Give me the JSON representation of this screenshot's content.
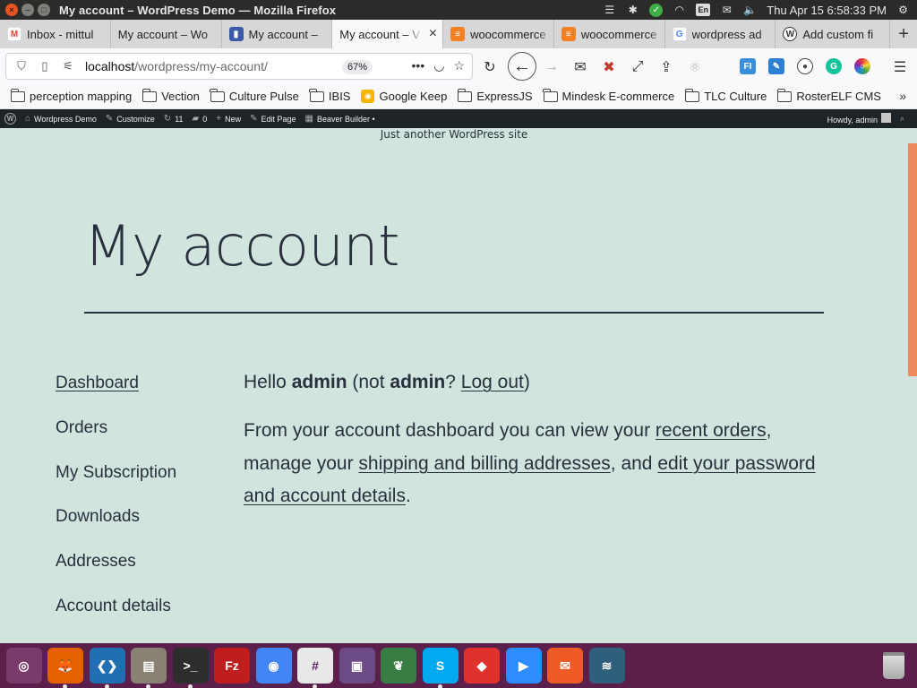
{
  "system": {
    "window_title": "My account – WordPress Demo — Mozilla Firefox",
    "clock": "Thu Apr 15  6:58:33 PM",
    "keyboard": "En"
  },
  "tabs": [
    {
      "label": "Inbox - mittul",
      "icon": "gmail-icon",
      "color": "#ea4335"
    },
    {
      "label": "My account – Wo",
      "icon": "page-icon",
      "color": "#888888"
    },
    {
      "label": "My account –",
      "icon": "chart-icon",
      "color": "#3b5ba9"
    },
    {
      "label": "My account – V",
      "icon": "page-icon",
      "color": "#888888",
      "active": true
    },
    {
      "label": "woocommerce",
      "icon": "stackoverflow-icon",
      "color": "#f48024"
    },
    {
      "label": "woocommerce",
      "icon": "stackoverflow-icon",
      "color": "#f48024"
    },
    {
      "label": "wordpress ad",
      "icon": "google-icon",
      "color": "#4285f4"
    },
    {
      "label": "Add custom fi",
      "icon": "wordpress-icon",
      "color": "#333333"
    }
  ],
  "url": {
    "host": "localhost",
    "path": "/wordpress/my-account/",
    "zoom": "67%"
  },
  "bookmarks": [
    {
      "label": "perception mapping",
      "type": "folder"
    },
    {
      "label": "Vection",
      "type": "folder"
    },
    {
      "label": "Culture Pulse",
      "type": "folder"
    },
    {
      "label": "IBIS",
      "type": "folder"
    },
    {
      "label": "Google Keep",
      "type": "keep"
    },
    {
      "label": "ExpressJS",
      "type": "folder"
    },
    {
      "label": "Mindesk E-commerce",
      "type": "folder"
    },
    {
      "label": "TLC Culture",
      "type": "folder"
    },
    {
      "label": "RosterELF CMS",
      "type": "folder"
    }
  ],
  "wpbar": {
    "site": "Wordpress Demo",
    "customize": "Customize",
    "updates": "11",
    "comments": "0",
    "new": "New",
    "edit": "Edit Page",
    "builder": "Beaver Builder •",
    "howdy": "Howdy, admin"
  },
  "site": {
    "tagline": "Just another WordPress site"
  },
  "page": {
    "title": "My account"
  },
  "account_nav": [
    {
      "label": "Dashboard",
      "current": true
    },
    {
      "label": "Orders"
    },
    {
      "label": "My Subscription"
    },
    {
      "label": "Downloads"
    },
    {
      "label": "Addresses"
    },
    {
      "label": "Account details"
    }
  ],
  "dashboard": {
    "hello": "Hello",
    "user": "admin",
    "not_prefix": " (not ",
    "not_user": "admin",
    "q": "? ",
    "logout": "Log out",
    "close": ")",
    "intro_1": "From your account dashboard you can view your ",
    "link_orders": "recent orders",
    "intro_2": ", manage your ",
    "link_addresses": "shipping and billing addresses",
    "intro_3": ", and ",
    "link_account": "edit your password and account details",
    "intro_4": "."
  },
  "colors": {
    "page_bg": "#d1e4dd",
    "text": "#28303d",
    "dock": "#5a1f4b",
    "scroll_accent": "#f08a5d"
  },
  "dock": [
    {
      "name": "ubuntu-icon",
      "color": "#7a3a6a",
      "glyph": "◎"
    },
    {
      "name": "firefox-icon",
      "color": "#e66000",
      "glyph": "🦊",
      "running": true
    },
    {
      "name": "vscode-icon",
      "color": "#1f6fb2",
      "glyph": "❮❯",
      "running": true
    },
    {
      "name": "files-icon",
      "color": "#8a8175",
      "glyph": "▤",
      "running": true
    },
    {
      "name": "terminal-icon",
      "color": "#2d2d2d",
      "glyph": ">_",
      "running": true
    },
    {
      "name": "filezilla-icon",
      "color": "#bf1e1e",
      "glyph": "Fz"
    },
    {
      "name": "chrome-icon",
      "color": "#4285f4",
      "glyph": "◉"
    },
    {
      "name": "slack-icon",
      "color": "#e8e8e8",
      "glyph": "#",
      "running": true
    },
    {
      "name": "video-icon",
      "color": "#6b4a85",
      "glyph": "▣"
    },
    {
      "name": "mongodb-icon",
      "color": "#3a7d44",
      "glyph": "❦"
    },
    {
      "name": "skype-icon",
      "color": "#00a9f0",
      "glyph": "S",
      "running": true
    },
    {
      "name": "anydesk-icon",
      "color": "#e0322d",
      "glyph": "◆"
    },
    {
      "name": "zoom-icon",
      "color": "#2d8cff",
      "glyph": "▶"
    },
    {
      "name": "postman-icon",
      "color": "#ef5b25",
      "glyph": "✉"
    },
    {
      "name": "workbench-icon",
      "color": "#2f5f7a",
      "glyph": "≋"
    }
  ]
}
